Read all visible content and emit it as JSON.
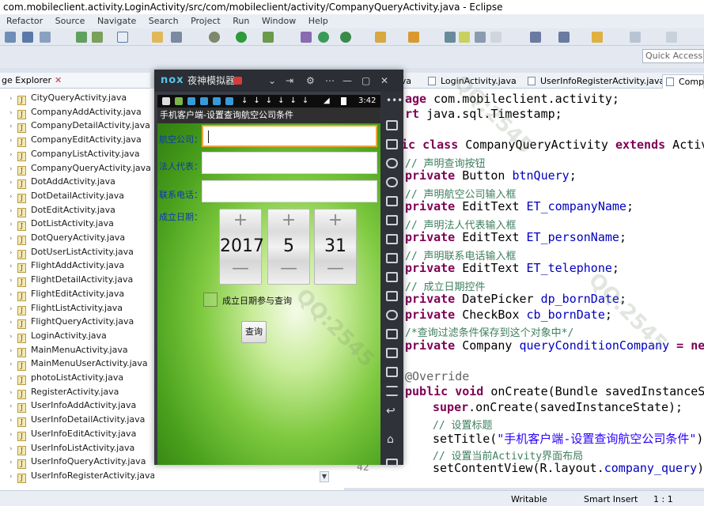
{
  "window": {
    "title": "com.mobileclient.activity.LoginActivity/src/com/mobileclient/activity/CompanyQueryActivity.java - Eclipse",
    "menu": [
      "Refactor",
      "Source",
      "Navigate",
      "Search",
      "Project",
      "Run",
      "Window",
      "Help"
    ],
    "quick_access": "Quick Access"
  },
  "package_explorer": {
    "tab_label": "ge Explorer",
    "files": [
      "CityQueryActivity.java",
      "CompanyAddActivity.java",
      "CompanyDetailActivity.java",
      "CompanyEditActivity.java",
      "CompanyListActivity.java",
      "CompanyQueryActivity.java",
      "DotAddActivity.java",
      "DotDetailActivity.java",
      "DotEditActivity.java",
      "DotListActivity.java",
      "DotQueryActivity.java",
      "DotUserListActivity.java",
      "FlightAddActivity.java",
      "FlightDetailActivity.java",
      "FlightEditActivity.java",
      "FlightListActivity.java",
      "FlightQueryActivity.java",
      "LoginActivity.java",
      "MainMenuActivity.java",
      "MainMenuUserActivity.java",
      "photoListActivity.java",
      "RegisterActivity.java",
      "UserInfoAddActivity.java",
      "UserInfoDetailActivity.java",
      "UserInfoEditActivity.java",
      "UserInfoListActivity.java",
      "UserInfoQueryActivity.java",
      "UserInfoRegisterActivity.java"
    ]
  },
  "editor": {
    "tabs": [
      "Util.java",
      "LoginActivity.java",
      "UserInfoRegisterActivity.java",
      "Comp"
    ],
    "lines": [
      {
        "t": "package",
        "k": "kw-prefix",
        "rest": " com.mobileclient.activity;"
      },
      {
        "t": "ort",
        "rest": " java.sql.Timestamp;"
      }
    ],
    "code": {
      "l1a": "age",
      "l1b": " com.mobileclient.activity;",
      "l2a": "rt",
      "l2b": " java.sql.Timestamp;",
      "l3a": "ic class",
      "l3b": " CompanyQueryActivity ",
      "l3c": "extends",
      "l3d": " Activ",
      "c1": "// 声明查询按钮",
      "l4a": "private",
      "l4b": " Button ",
      "l4c": "btnQuery",
      "l4d": ";",
      "c2": "// 声明航空公司输入框",
      "l5a": "private",
      "l5b": " EditText ",
      "l5c": "ET_companyName",
      "l5d": ";",
      "c3": "// 声明法人代表输入框",
      "l6a": "private",
      "l6b": " EditText ",
      "l6c": "ET_personName",
      "l6d": ";",
      "c4": "// 声明联系电话输入框",
      "l7a": "private",
      "l7b": " EditText ",
      "l7c": "ET_telephone",
      "l7d": ";",
      "c5": "// 成立日期控件",
      "l8a": "private",
      "l8b": " DatePicker ",
      "l8c": "dp_bornDate",
      "l8d": ";",
      "l9a": "private",
      "l9b": " CheckBox ",
      "l9c": "cb_bornDate",
      "l9d": ";",
      "c6": "/*查询过滤条件保存到这个对象中*/",
      "l10a": "private",
      "l10b": " Company ",
      "l10c": "queryConditionCompany",
      "l10d": " = new",
      "l11": "@Override",
      "l12a": "public void",
      "l12b": " onCreate(Bundle savedInstanceSt",
      "l13a": "super",
      "l13b": ".onCreate(savedInstanceState);",
      "c7": "// 设置标题",
      "l14a": "setTitle(",
      "l14b": "\"手机客户端-设置查询航空公司条件\"",
      "l14c": ");",
      "c8": "// 设置当前Activity界面布局",
      "l15a": "setContentView(R.layout.",
      "l15b": "company_query",
      "l15c": ");"
    },
    "gutter_line": "42"
  },
  "status": {
    "mode": "Writable",
    "insert": "Smart Insert",
    "position": "1 : 1"
  },
  "emulator": {
    "logo": "nox",
    "name": "夜神模拟器",
    "time": "3:42",
    "app_title": "手机客户端-设置查询航空公司条件",
    "labels": {
      "company": "航空公司：",
      "person": "法人代表：",
      "telephone": "联系电话：",
      "born_date": "成立日期："
    },
    "date": {
      "year": "2017",
      "month": "5",
      "day": "31"
    },
    "checkbox_label": "成立日期参与查询",
    "query_button": "查询"
  },
  "colors": {
    "keyword": "#7f0055",
    "field": "#0000c0",
    "comment": "#3f7f5f",
    "string": "#2a00ff",
    "focus_border": "#f0a43a"
  }
}
